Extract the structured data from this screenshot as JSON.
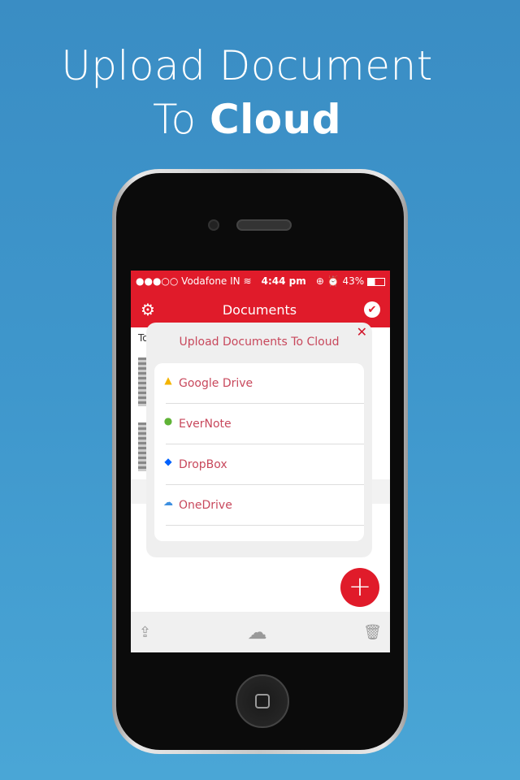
{
  "headline": {
    "line1": "Upload Document",
    "line2_prefix": "To ",
    "line2_bold": "Cloud"
  },
  "status_bar": {
    "carrier": "●●●○○ Vodafone IN",
    "wifi": "wifi-icon",
    "time": "4:44 pm",
    "right": "⊕ ⏰ 43%",
    "battery": "43%"
  },
  "navbar": {
    "title": "Documents",
    "left_icon": "gear-icon",
    "right_icon": "check-circle-icon"
  },
  "background_list": {
    "partial_label": "To"
  },
  "modal": {
    "title": "Upload Documents To Cloud",
    "close": "✕",
    "items": [
      {
        "label": "Google Drive",
        "icon": "google-drive-icon",
        "color": "#f4b400"
      },
      {
        "label": "EverNote",
        "icon": "evernote-icon",
        "color": "#5fb336"
      },
      {
        "label": "DropBox",
        "icon": "dropbox-icon",
        "color": "#0061fe"
      },
      {
        "label": "OneDrive",
        "icon": "onedrive-icon",
        "color": "#3c8fe0"
      }
    ]
  },
  "fab": {
    "label": "+"
  },
  "toolbar": {
    "icons": [
      "share-icon",
      "cloud-upload-icon",
      "trash-icon"
    ]
  },
  "colors": {
    "accent": "#e01b2a",
    "text": "#c8485c",
    "background": "#3f97cc"
  }
}
